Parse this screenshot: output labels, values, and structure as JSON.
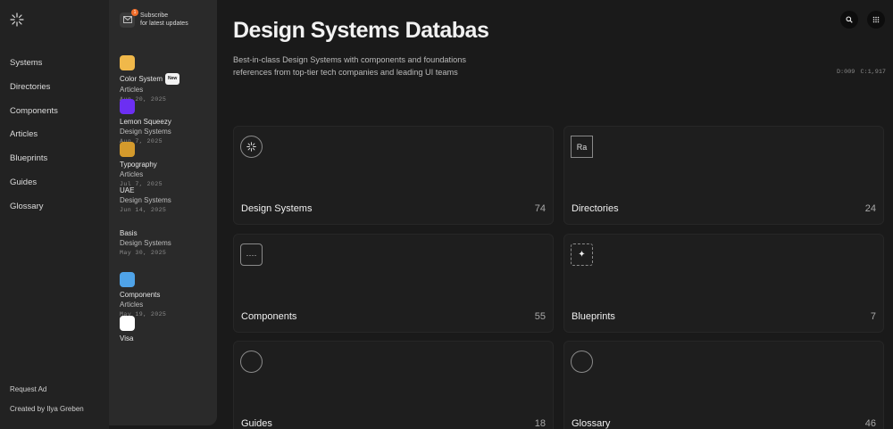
{
  "nav": {
    "logo": "sparkle-logo",
    "items": [
      "Systems",
      "Directories",
      "Components",
      "Articles",
      "Blueprints",
      "Guides",
      "Glossary"
    ],
    "footer": [
      "Request Ad",
      "Created by Ilya Greben"
    ]
  },
  "subscribe": {
    "badge": "1",
    "line1": "Subscribe",
    "line2": "for latest updates"
  },
  "feed": [
    {
      "title": "Color System",
      "badge": "New",
      "category": "Articles",
      "date": "Aug 20, 2025",
      "thumb": "#f0b84a"
    },
    {
      "title": "Lemon Squeezy",
      "badge": "",
      "category": "Design Systems",
      "date": "Aug 7, 2025",
      "thumb": "#6c2ff2"
    },
    {
      "title": "Typography",
      "badge": "",
      "category": "Articles",
      "date": "Jul 7, 2025",
      "thumb": "#d49a2c"
    },
    {
      "title": "UAE",
      "badge": "",
      "category": "Design Systems",
      "date": "Jun 14, 2025",
      "thumb": ""
    },
    {
      "title": "Basis",
      "badge": "",
      "category": "Design Systems",
      "date": "May 30, 2025",
      "thumb": ""
    },
    {
      "title": "Components",
      "badge": "",
      "category": "Articles",
      "date": "May 19, 2025",
      "thumb": "#4fa3e8"
    },
    {
      "title": "Visa",
      "badge": "",
      "category": "",
      "date": "",
      "thumb": "#ffffff"
    }
  ],
  "header": {
    "title": "Design Systems Databas",
    "description": "Best-in-class Design Systems with components and foundations references from top-tier tech companies and leading UI teams",
    "counters": "D:009 C:1,917"
  },
  "cards": [
    {
      "label": "Design Systems",
      "count": "74",
      "icon": "sparkle-icon"
    },
    {
      "label": "Directories",
      "count": "24",
      "icon": "type-icon",
      "icon_text": "Ra"
    },
    {
      "label": "Components",
      "count": "55",
      "icon": "dots-icon"
    },
    {
      "label": "Blueprints",
      "count": "7",
      "icon": "star-icon"
    },
    {
      "label": "Guides",
      "count": "18",
      "icon": "circle-icon"
    },
    {
      "label": "Glossary",
      "count": "46",
      "icon": "circle-icon"
    }
  ]
}
